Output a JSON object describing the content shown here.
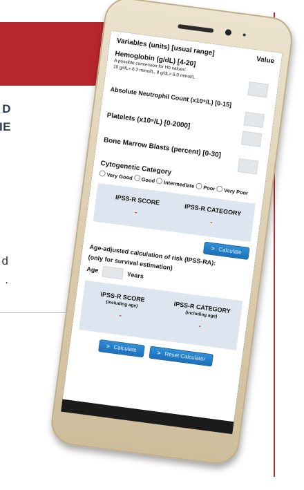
{
  "background": {
    "heading_line1": "D",
    "heading_line2": "IE",
    "text_line1": "d",
    "text_line2": "."
  },
  "calculator": {
    "header": {
      "variables": "Variables (units) [usual range]",
      "value": "Value"
    },
    "hemoglobin": {
      "label": "Hemoglobin (g/dL) [4-20]",
      "note1": "A possible conversion for Hb values:",
      "note2": "10 g/dL= 6.2 mmol/L, 8 g/dL= 5.0 mmol/L"
    },
    "anc": {
      "label": "Absolute Neutrophil Count (x10⁹/L) [0-15]"
    },
    "platelets": {
      "label": "Platelets (x10⁹/L) [0-2000]"
    },
    "blasts": {
      "label": "Bone Marrow Blasts (percent) [0-30]"
    },
    "cytogenetic": {
      "label": "Cytogenetic Category",
      "options": [
        "Very Good",
        "Good",
        "Intermediate",
        "Poor",
        "Very Poor"
      ]
    },
    "result": {
      "score_title": "IPSS-R SCORE",
      "category_title": "IPSS-R CATEGORY",
      "score_value": "-",
      "category_value": "-"
    },
    "calculate_label": "Calculate",
    "age_adjusted": {
      "title": "Age-adjusted calculation of risk (IPSS-RA):",
      "subtitle": "(only for survival estimation)",
      "age_label": "Age",
      "years_label": "Years",
      "score_title": "IPSS-R SCORE",
      "score_sub": "(including age)",
      "category_title": "IPSS-R CATEGORY",
      "category_sub": "(including age)",
      "score_value": "-",
      "category_value": "-"
    },
    "bottom_buttons": {
      "calculate": "Calculate",
      "reset": "Reset Calculator"
    }
  },
  "colors": {
    "banner": "#b5272d",
    "button": "#1c6fb9",
    "panel": "#dde6f0",
    "dash": "#e0261e"
  }
}
